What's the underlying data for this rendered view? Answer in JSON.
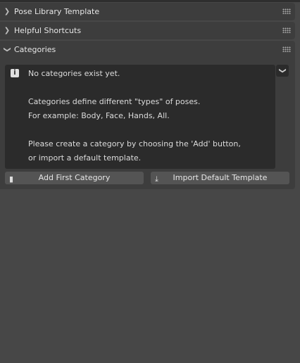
{
  "panels": [
    {
      "title": "Pose Library Template",
      "expanded": false
    },
    {
      "title": "Helpful Shortcuts",
      "expanded": false
    },
    {
      "title": "Categories",
      "expanded": true
    }
  ],
  "categories": {
    "info_lines": [
      "No categories exist yet.",
      "Categories define different \"types\" of poses.",
      "For example: Body, Face, Hands, All.",
      "Please create a category by choosing the 'Add' button,",
      "or import a default template."
    ],
    "add_button": "Add First Category",
    "import_button": "Import Default Template"
  }
}
